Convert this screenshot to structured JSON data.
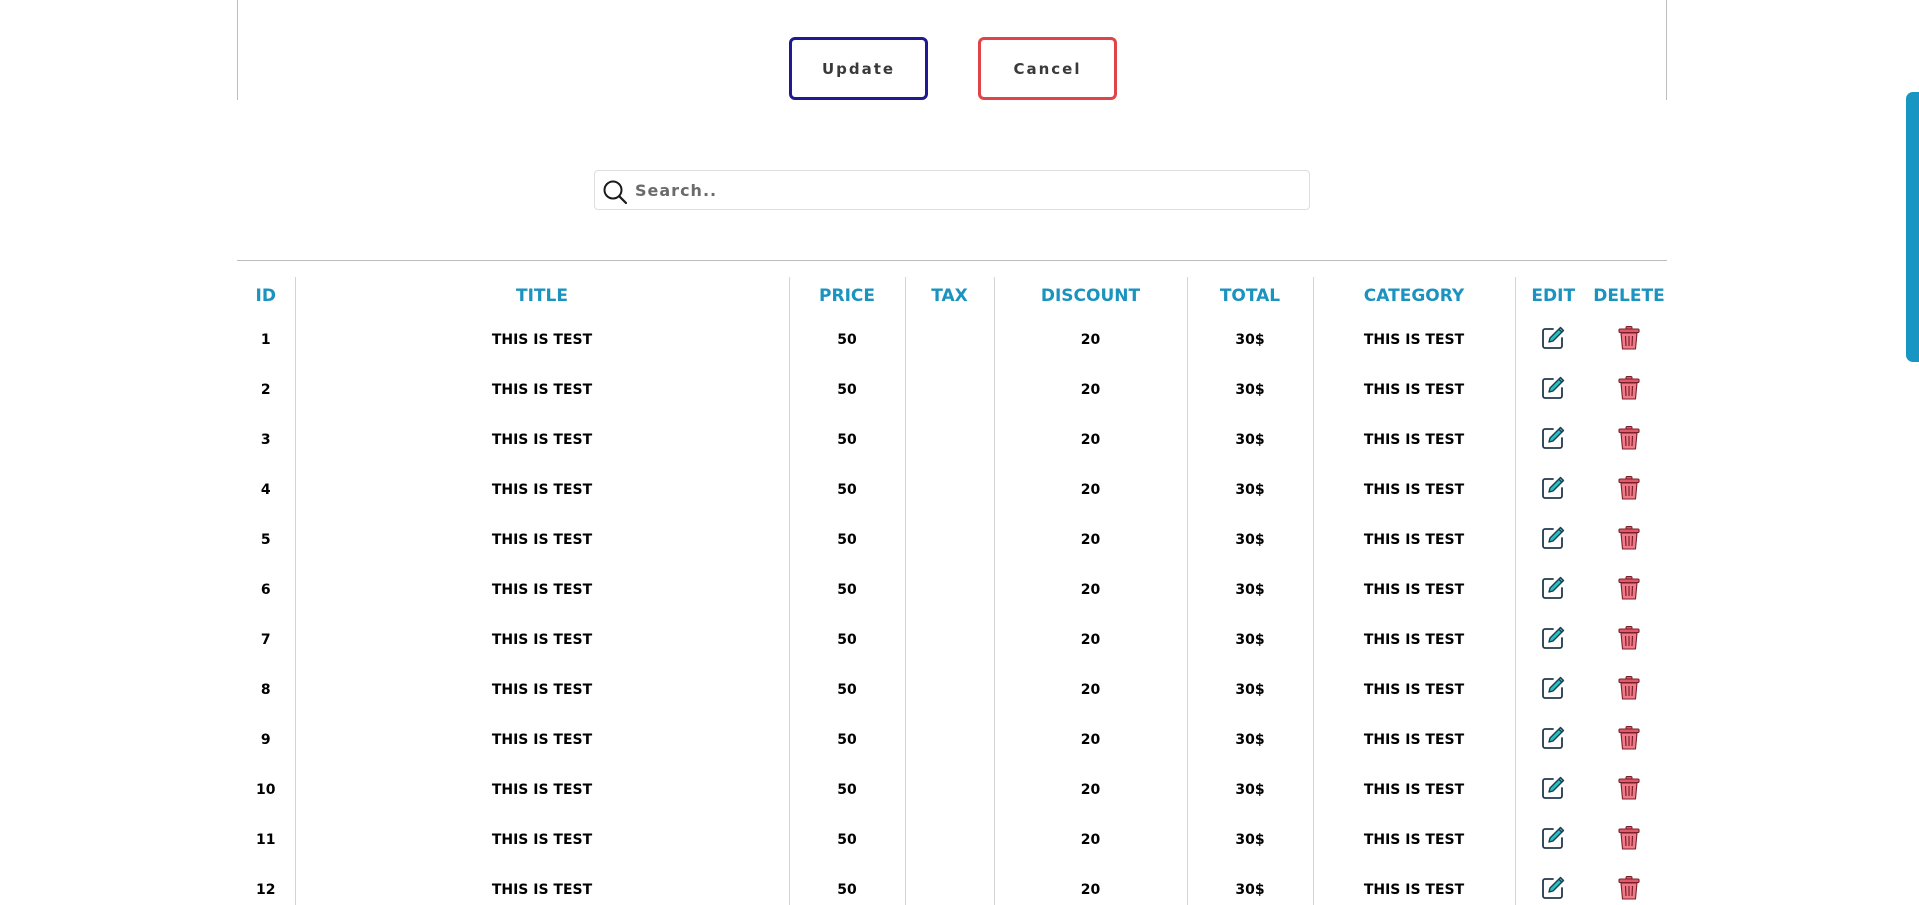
{
  "form": {
    "update_label": "Update",
    "cancel_label": "Cancel",
    "update_color": "#1f1a8f",
    "cancel_color": "#e04448"
  },
  "search": {
    "placeholder": "Search.."
  },
  "table": {
    "header_color": "#1a93c0",
    "headers": [
      "ID",
      "TITLE",
      "PRICE",
      "TAX",
      "DISCOUNT",
      "TOTAL",
      "CATEGORY",
      "EDIT",
      "DELETE"
    ],
    "rows": [
      {
        "id": "1",
        "title": "THIS IS TEST",
        "price": "50",
        "tax": "",
        "discount": "20",
        "total": "30$",
        "category": "THIS IS TEST"
      },
      {
        "id": "2",
        "title": "THIS IS TEST",
        "price": "50",
        "tax": "",
        "discount": "20",
        "total": "30$",
        "category": "THIS IS TEST"
      },
      {
        "id": "3",
        "title": "THIS IS TEST",
        "price": "50",
        "tax": "",
        "discount": "20",
        "total": "30$",
        "category": "THIS IS TEST"
      },
      {
        "id": "4",
        "title": "THIS IS TEST",
        "price": "50",
        "tax": "",
        "discount": "20",
        "total": "30$",
        "category": "THIS IS TEST"
      },
      {
        "id": "5",
        "title": "THIS IS TEST",
        "price": "50",
        "tax": "",
        "discount": "20",
        "total": "30$",
        "category": "THIS IS TEST"
      },
      {
        "id": "6",
        "title": "THIS IS TEST",
        "price": "50",
        "tax": "",
        "discount": "20",
        "total": "30$",
        "category": "THIS IS TEST"
      },
      {
        "id": "7",
        "title": "THIS IS TEST",
        "price": "50",
        "tax": "",
        "discount": "20",
        "total": "30$",
        "category": "THIS IS TEST"
      },
      {
        "id": "8",
        "title": "THIS IS TEST",
        "price": "50",
        "tax": "",
        "discount": "20",
        "total": "30$",
        "category": "THIS IS TEST"
      },
      {
        "id": "9",
        "title": "THIS IS TEST",
        "price": "50",
        "tax": "",
        "discount": "20",
        "total": "30$",
        "category": "THIS IS TEST"
      },
      {
        "id": "10",
        "title": "THIS IS TEST",
        "price": "50",
        "tax": "",
        "discount": "20",
        "total": "30$",
        "category": "THIS IS TEST"
      },
      {
        "id": "11",
        "title": "THIS IS TEST",
        "price": "50",
        "tax": "",
        "discount": "20",
        "total": "30$",
        "category": "THIS IS TEST"
      },
      {
        "id": "12",
        "title": "THIS IS TEST",
        "price": "50",
        "tax": "",
        "discount": "20",
        "total": "30$",
        "category": "THIS IS TEST"
      }
    ],
    "edit_icon": "edit-icon",
    "delete_icon": "trash-icon"
  }
}
